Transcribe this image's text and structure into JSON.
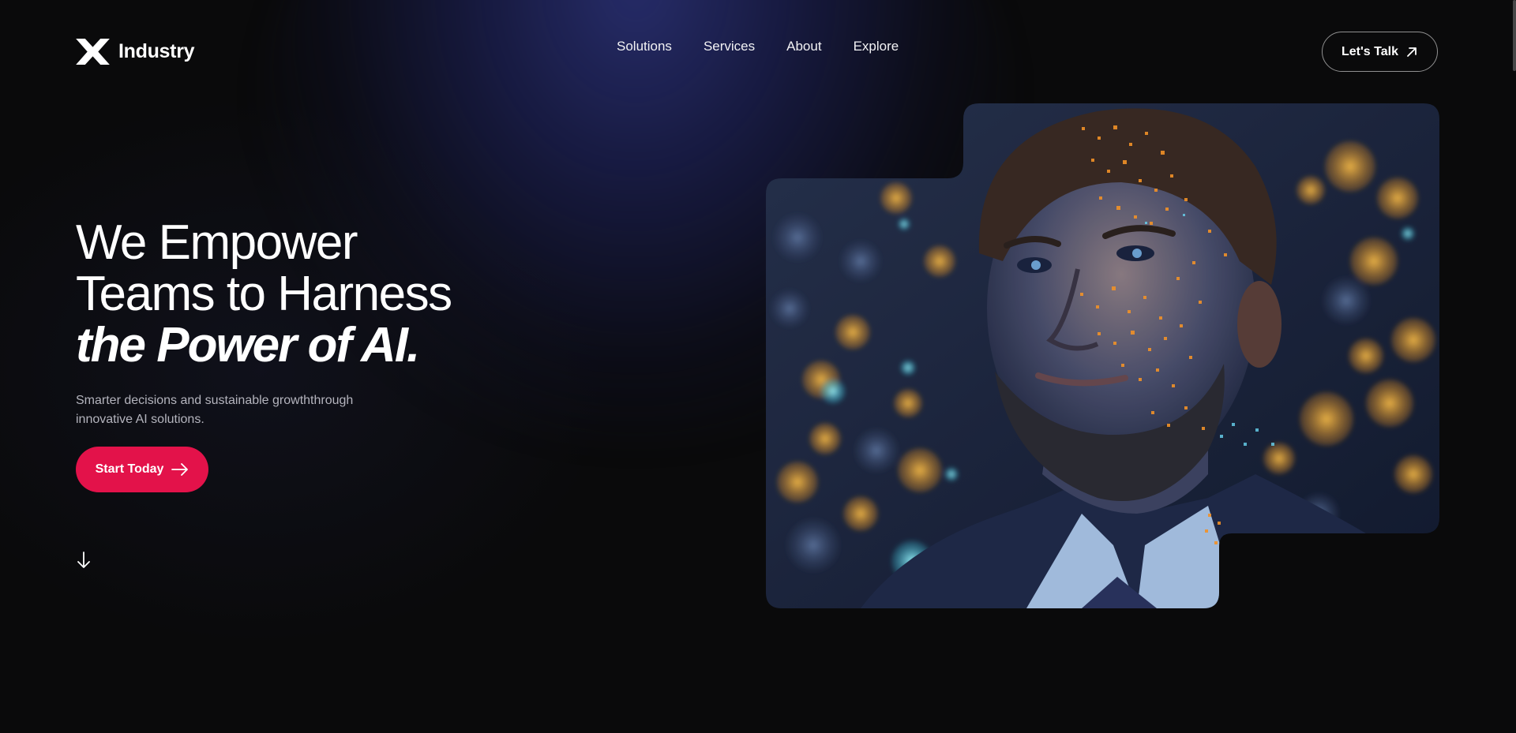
{
  "brand": {
    "name": "Industry",
    "logo_icon": "x-logo-icon"
  },
  "nav": {
    "items": [
      {
        "label": "Solutions"
      },
      {
        "label": "Services"
      },
      {
        "label": "About"
      },
      {
        "label": "Explore"
      }
    ],
    "cta_label": "Let's Talk",
    "cta_icon": "arrow-up-right-icon"
  },
  "hero": {
    "headline_line1": "We Empower",
    "headline_line2": "Teams to Harness",
    "headline_accent": "the Power of AI.",
    "subtitle": "Smarter decisions and sustainable growththrough innovative AI solutions.",
    "cta_label": "Start Today",
    "cta_icon": "arrow-right-icon",
    "scroll_icon": "arrow-down-icon",
    "image_icon": "ai-portrait-image"
  },
  "colors": {
    "background": "#0a0a0b",
    "accent": "#e3124a",
    "glow": "#282e6e",
    "text_muted": "#b4b4bd"
  }
}
